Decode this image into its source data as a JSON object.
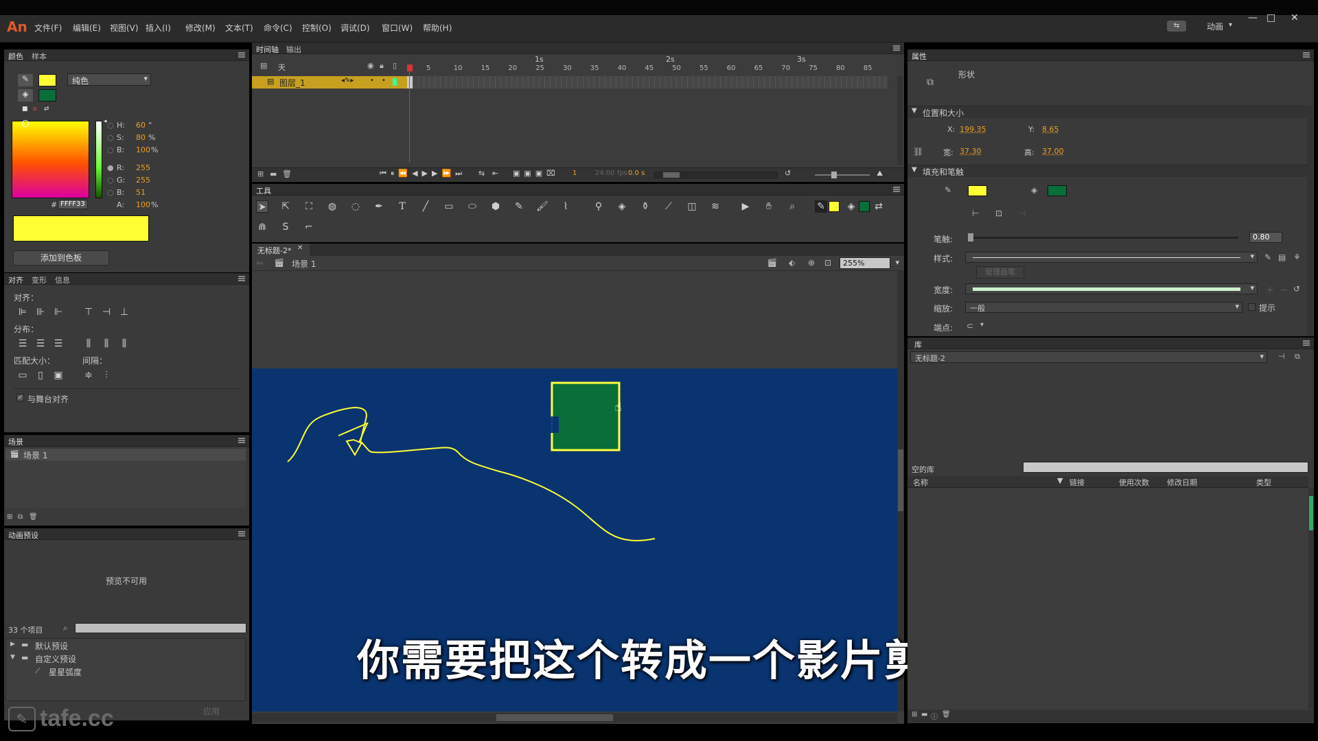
{
  "app": {
    "logo": "An",
    "workspace": "动画"
  },
  "menu": [
    "文件(F)",
    "编辑(E)",
    "视图(V)",
    "插入(I)",
    "修改(M)",
    "文本(T)",
    "命令(C)",
    "控制(O)",
    "调试(D)",
    "窗口(W)",
    "帮助(H)"
  ],
  "color_panel": {
    "tabs": [
      "颜色",
      "样本"
    ],
    "fill_type": "纯色",
    "h": "60",
    "h_unit": "°",
    "s": "80",
    "s_unit": "%",
    "b": "100",
    "b_unit": "%",
    "r": "255",
    "g": "255",
    "bl": "51",
    "hex_label": "#",
    "hex": "FFFF33",
    "alpha": "100",
    "alpha_unit": "%",
    "labels": {
      "h": "H:",
      "s": "S:",
      "b": "B:",
      "r": "R:",
      "g": "G:",
      "bl": "B:",
      "a": "A:"
    },
    "add_button": "添加到色板",
    "colors": {
      "stroke": "#ffff33",
      "fill": "#0a6e3a",
      "preview": "#ffff33"
    }
  },
  "align_panel": {
    "tabs": [
      "对齐",
      "变形",
      "信息"
    ],
    "align_label": "对齐：",
    "distribute_label": "分布：",
    "match_label": "匹配大小：",
    "spacing_label": "间隔：",
    "stage_align": "与舞台对齐"
  },
  "scene_panel": {
    "title": "场景",
    "items": [
      "场景 1"
    ]
  },
  "motion_presets": {
    "title": "动画预设",
    "preview_text": "预览不可用",
    "count": "33 个项目",
    "folders": [
      "默认预设",
      "自定义预设"
    ],
    "items": [
      "星星弧度"
    ],
    "apply": "应用"
  },
  "timeline": {
    "tabs": [
      "时间轴",
      "输出"
    ],
    "layer_header": "天",
    "layer_name": "图层_1",
    "seconds": [
      "1s",
      "2s",
      "3s"
    ],
    "frame_numbers": [
      "5",
      "10",
      "15",
      "20",
      "25",
      "30",
      "35",
      "40",
      "45",
      "50",
      "55",
      "60",
      "65",
      "70",
      "75",
      "80",
      "85"
    ],
    "current_frame": "1",
    "fps": "24.00 fps",
    "time": "0.0 s"
  },
  "tools": {
    "title": "工具"
  },
  "document": {
    "tab": "无标题-2*",
    "scene": "场景 1",
    "zoom": "255%",
    "stage_color": "#0a3470",
    "shape_stroke": "#ffff33",
    "shape_fill": "#0a6e3a"
  },
  "properties": {
    "title": "属性",
    "type": "形状",
    "position_section": "位置和大小",
    "x_label": "X:",
    "x": "199.35",
    "y_label": "Y:",
    "y": "8.65",
    "w_label": "宽:",
    "w": "37.30",
    "h_label": "高:",
    "h": "37.00",
    "fill_stroke_section": "填充和笔触",
    "stroke_label": "笔触:",
    "stroke": "0.80",
    "style_label": "样式:",
    "manage_label": "管理画笔",
    "width_label": "宽度:",
    "scale_label": "缩放:",
    "scale": "一般",
    "hint_label": "提示",
    "cap_label": "端点:"
  },
  "library": {
    "title": "库",
    "document": "无标题-2",
    "empty_label": "空的库",
    "columns": [
      "名称",
      "链接",
      "使用次数",
      "修改日期",
      "类型"
    ]
  },
  "subtitle": "你需要把这个转成一个影片剪辑",
  "watermark": "tafe.cc"
}
